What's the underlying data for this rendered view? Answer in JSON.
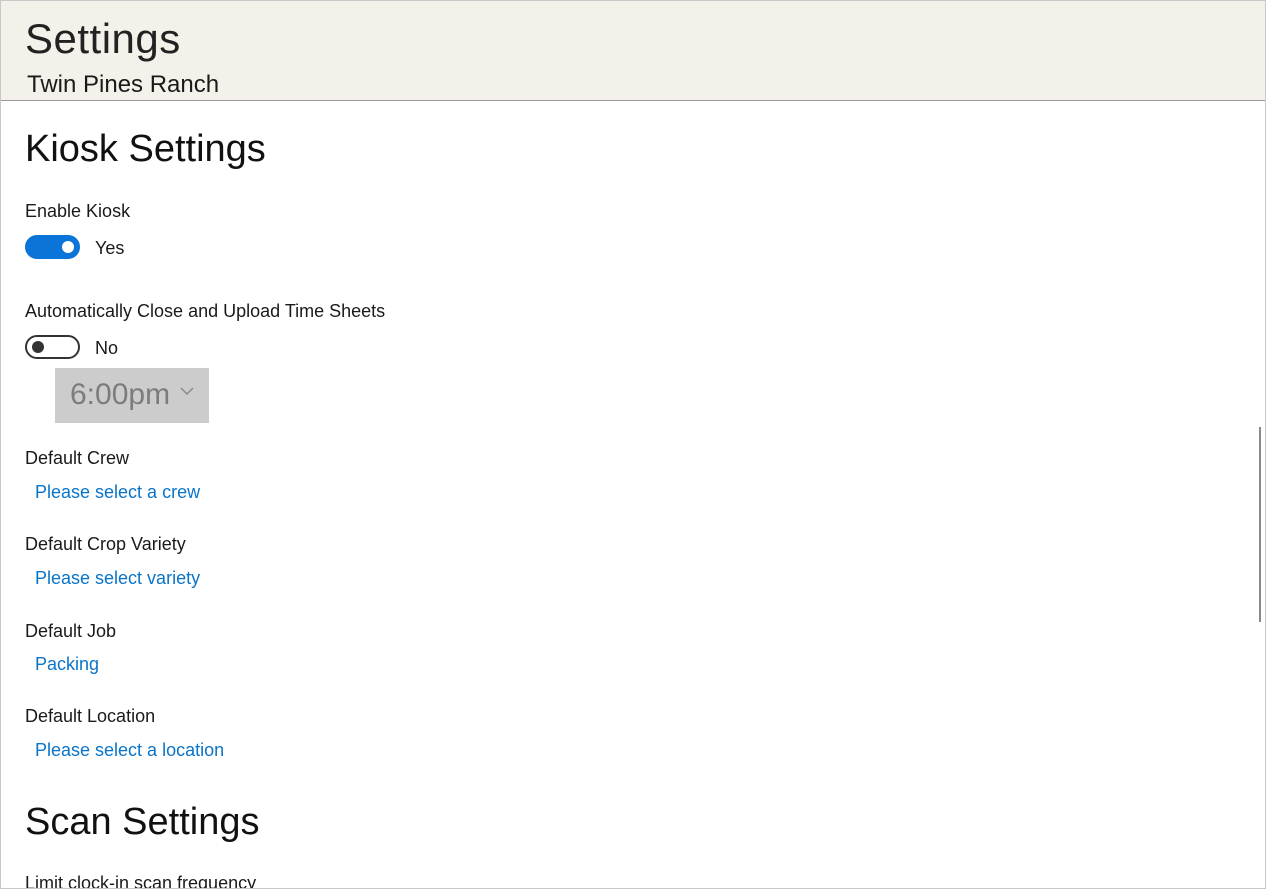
{
  "header": {
    "title": "Settings",
    "subtitle": "Twin Pines Ranch"
  },
  "kiosk": {
    "section_title": "Kiosk Settings",
    "enable_kiosk": {
      "label": "Enable Kiosk",
      "state": "on",
      "state_text": "Yes"
    },
    "auto_close": {
      "label": "Automatically Close and Upload Time Sheets",
      "state": "off",
      "state_text": "No",
      "time_value": "6:00pm",
      "time_enabled": false
    },
    "default_crew": {
      "label": "Default Crew",
      "value": "Please select a crew"
    },
    "default_crop_variety": {
      "label": "Default Crop Variety",
      "value": "Please select variety"
    },
    "default_job": {
      "label": "Default Job",
      "value": "Packing"
    },
    "default_location": {
      "label": "Default Location",
      "value": "Please select a location"
    }
  },
  "scan": {
    "section_title": "Scan Settings",
    "limit_clock_in": {
      "label": "Limit clock-in scan frequency"
    }
  },
  "colors": {
    "header_bg": "#f4f1ea",
    "accent": "#0a74d8",
    "link": "#0a74c9",
    "disabled_bg": "#cccccc"
  }
}
